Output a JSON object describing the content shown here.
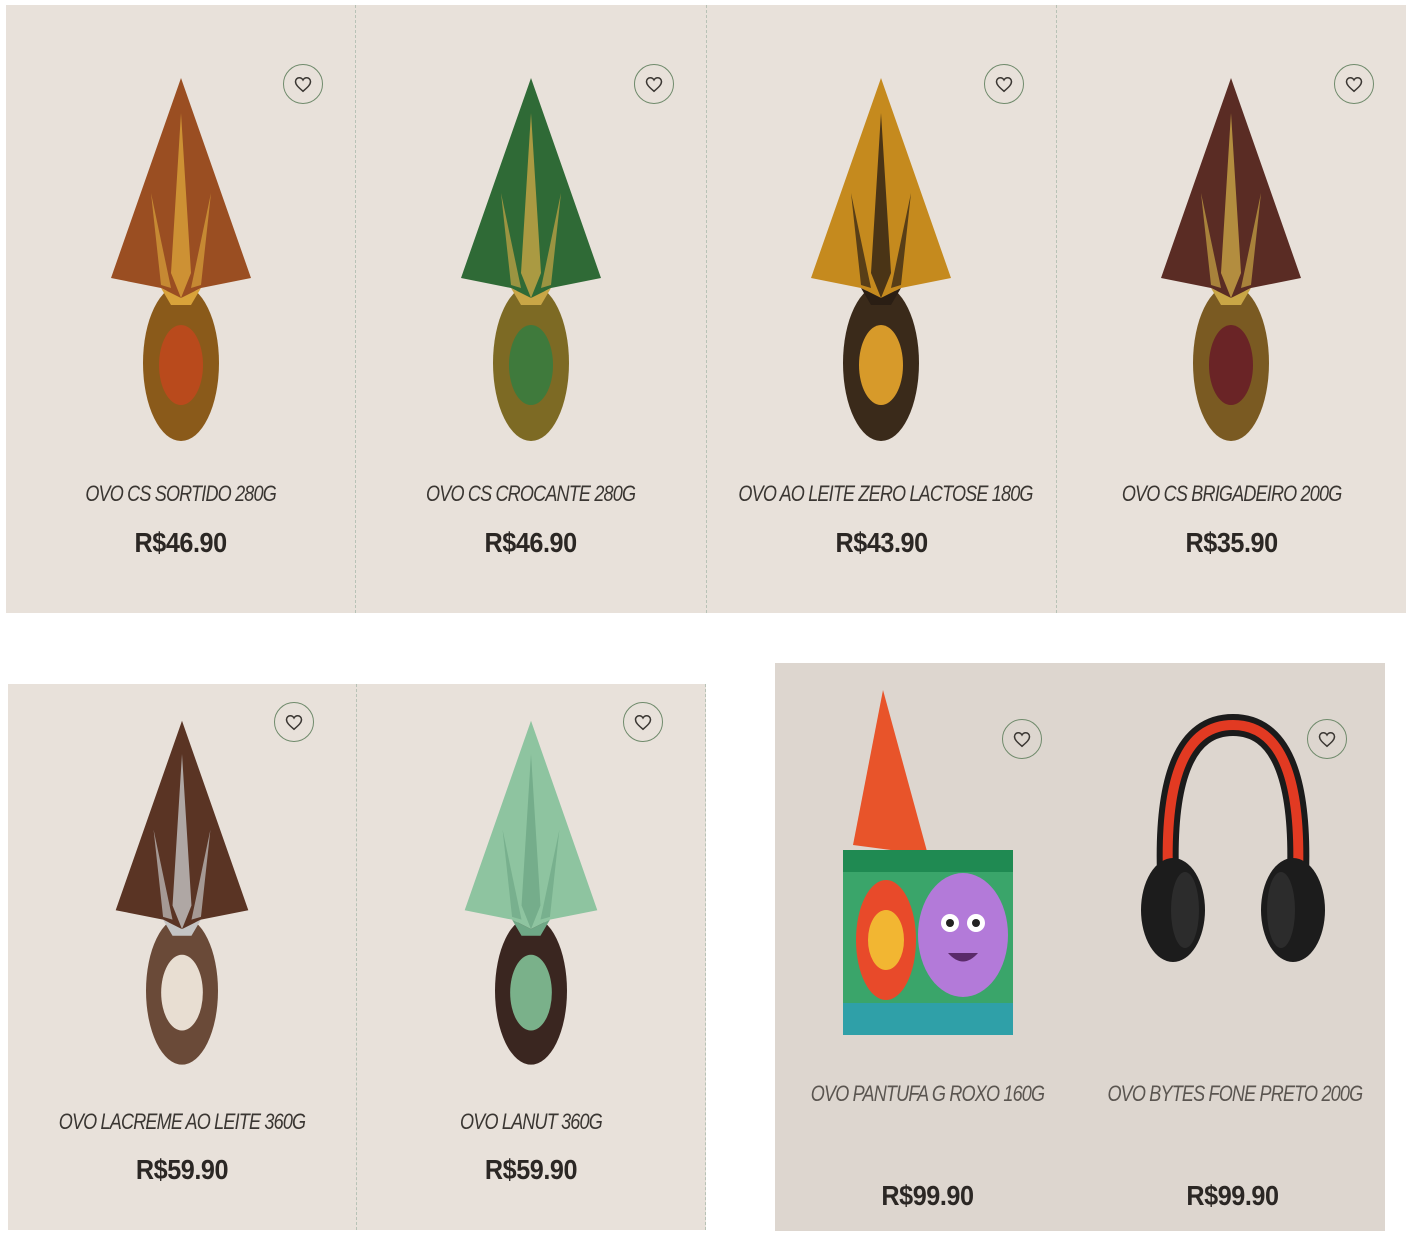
{
  "colors": {
    "panel_bg": "#e8e1da",
    "panel_bg_alt": "#ddd6cf",
    "fav_border": "#6f8a6b",
    "divider": "#b8c2b6",
    "text": "#2b2724"
  },
  "icons": {
    "favorite": "heart-icon"
  },
  "row1": [
    {
      "name": "OVO CS SORTIDO 280G",
      "price": "R$46.90"
    },
    {
      "name": "OVO CS CROCANTE 280G",
      "price": "R$46.90"
    },
    {
      "name": "OVO AO LEITE ZERO LACTOSE 180G",
      "price": "R$43.90"
    },
    {
      "name": "OVO CS BRIGADEIRO 200G",
      "price": "R$35.90"
    }
  ],
  "row2_left": [
    {
      "name": "OVO LACREME AO LEITE 360G",
      "price": "R$59.90"
    },
    {
      "name": "OVO LANUT 360G",
      "price": "R$59.90"
    }
  ],
  "row2_right": [
    {
      "name": "OVO PANTUFA G ROXO 160G",
      "price": "R$99.90"
    },
    {
      "name": "OVO BYTES FONE PRETO 200G",
      "price": "R$99.90"
    }
  ]
}
